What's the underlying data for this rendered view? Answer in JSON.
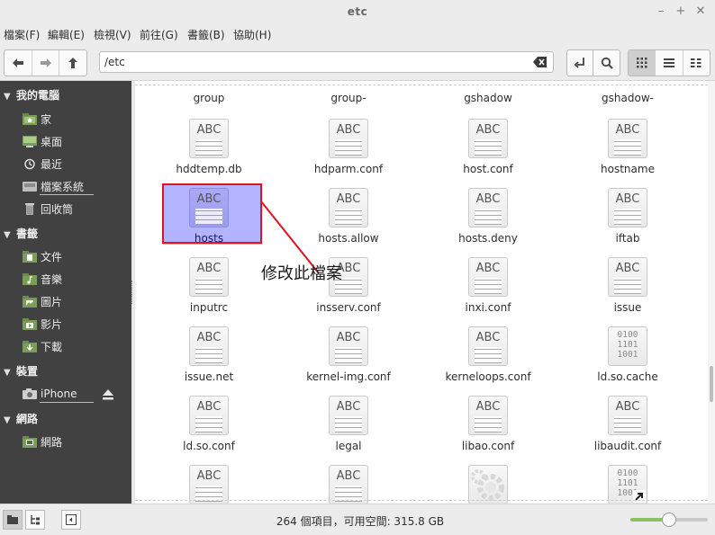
{
  "window": {
    "title": "etc",
    "minimize_label": "–",
    "maximize_label": "+",
    "close_label": "✕"
  },
  "menubar": [
    {
      "label": "檔案(F)"
    },
    {
      "label": "編輯(E)"
    },
    {
      "label": "檢視(V)"
    },
    {
      "label": "前往(G)"
    },
    {
      "label": "書籤(B)"
    },
    {
      "label": "協助(H)"
    }
  ],
  "toolbar": {
    "back_icon": "arrow-left-icon",
    "forward_icon": "arrow-right-icon",
    "up_icon": "arrow-up-icon",
    "location": "/etc",
    "clear_icon": "clear-location-icon",
    "toggle_location_icon": "toggle-location-icon",
    "search_icon": "search-icon",
    "views": [
      {
        "name": "icon-view-button",
        "icon": "grid-icon",
        "active": true
      },
      {
        "name": "list-view-button",
        "icon": "list-icon",
        "active": false
      },
      {
        "name": "compact-view-button",
        "icon": "compact-icon",
        "active": false
      }
    ]
  },
  "sidebar": {
    "sections": [
      {
        "title": "我的電腦",
        "items": [
          {
            "label": "家",
            "icon": "home-folder-icon"
          },
          {
            "label": "桌面",
            "icon": "desktop-icon"
          },
          {
            "label": "最近",
            "icon": "recent-icon"
          },
          {
            "label": "檔案系統",
            "icon": "filesystem-icon"
          },
          {
            "label": "回收筒",
            "icon": "trash-icon"
          }
        ]
      },
      {
        "title": "書籤",
        "items": [
          {
            "label": "文件",
            "icon": "documents-folder-icon"
          },
          {
            "label": "音樂",
            "icon": "music-folder-icon"
          },
          {
            "label": "圖片",
            "icon": "pictures-folder-icon"
          },
          {
            "label": "影片",
            "icon": "videos-folder-icon"
          },
          {
            "label": "下載",
            "icon": "downloads-folder-icon"
          }
        ]
      },
      {
        "title": "裝置",
        "items": [
          {
            "label": "iPhone",
            "icon": "camera-device-icon",
            "eject_icon": "eject-icon"
          }
        ]
      },
      {
        "title": "網路",
        "items": [
          {
            "label": "網路",
            "icon": "network-icon"
          }
        ]
      }
    ]
  },
  "files": {
    "partial_row": [
      "group",
      "group-",
      "gshadow",
      "gshadow-"
    ],
    "rows": [
      [
        {
          "name": "hddtemp.db",
          "type": "text"
        },
        {
          "name": "hdparm.conf",
          "type": "text"
        },
        {
          "name": "host.conf",
          "type": "text"
        },
        {
          "name": "hostname",
          "type": "text"
        }
      ],
      [
        {
          "name": "hosts",
          "type": "text",
          "selected": true
        },
        {
          "name": "hosts.allow",
          "type": "text"
        },
        {
          "name": "hosts.deny",
          "type": "text"
        },
        {
          "name": "iftab",
          "type": "text"
        }
      ],
      [
        {
          "name": "inputrc",
          "type": "text"
        },
        {
          "name": "insserv.conf",
          "type": "text"
        },
        {
          "name": "inxi.conf",
          "type": "text"
        },
        {
          "name": "issue",
          "type": "text"
        }
      ],
      [
        {
          "name": "issue.net",
          "type": "text"
        },
        {
          "name": "kernel-img.conf",
          "type": "text"
        },
        {
          "name": "kerneloops.conf",
          "type": "text"
        },
        {
          "name": "ld.so.cache",
          "type": "binary"
        }
      ],
      [
        {
          "name": "ld.so.conf",
          "type": "text"
        },
        {
          "name": "legal",
          "type": "text"
        },
        {
          "name": "libao.conf",
          "type": "text"
        },
        {
          "name": "libaudit.conf",
          "type": "text"
        }
      ],
      [
        {
          "name": "",
          "type": "text"
        },
        {
          "name": "",
          "type": "text"
        },
        {
          "name": "",
          "type": "executable"
        },
        {
          "name": "",
          "type": "binary-link"
        }
      ]
    ],
    "text_icon_label": "ABC",
    "binary_icon_lines": [
      "0100",
      "1101",
      "1001"
    ]
  },
  "annotation": {
    "text": "修改此檔案",
    "color": "#e0141e"
  },
  "statusbar": {
    "text": "264 個項目，可用空間: 315.8 GB",
    "zoom_level": 0.5
  },
  "colors": {
    "sidebar_bg": "#414141",
    "selection": "#b3b3ff",
    "zoom_fill": "#8fbf63"
  }
}
